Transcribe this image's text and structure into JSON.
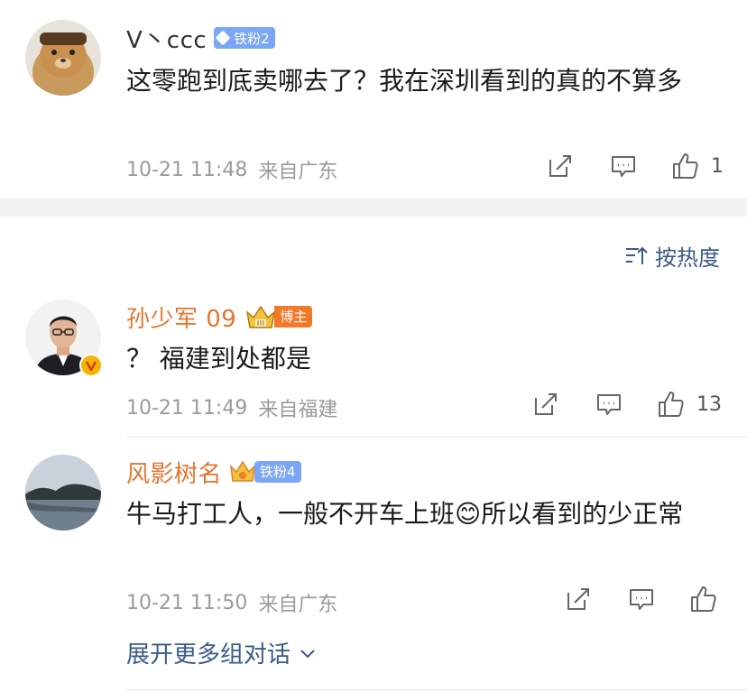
{
  "comment1": {
    "username": "V丶ccc",
    "badge": "铁粉2",
    "text": "这零跑到底卖哪去了？我在深圳看到的真的不算多",
    "time": "10-21 11:48",
    "location": "来自广东",
    "like_count": "1"
  },
  "sort": {
    "label": "按热度"
  },
  "comment2": {
    "username": "孙少军 09",
    "badge": "博主",
    "text": "？ 福建到处都是",
    "time": "10-21 11:49",
    "location": "来自福建",
    "like_count": "13"
  },
  "comment3": {
    "username": "风影树名",
    "badge": "铁粉4",
    "text_before": "牛马打工人，一般不开车上班",
    "emoji": "😊",
    "text_after": "所以看到的少正常",
    "time": "10-21 11:50",
    "location": "来自广东",
    "like_count": ""
  },
  "expand": {
    "label": "展开更多组对话"
  },
  "colors": {
    "accent_orange": "#e8742f",
    "link_blue": "#3c5a8a",
    "fan_badge": "#7aa6f5",
    "blogger_badge": "#f07a2a"
  }
}
